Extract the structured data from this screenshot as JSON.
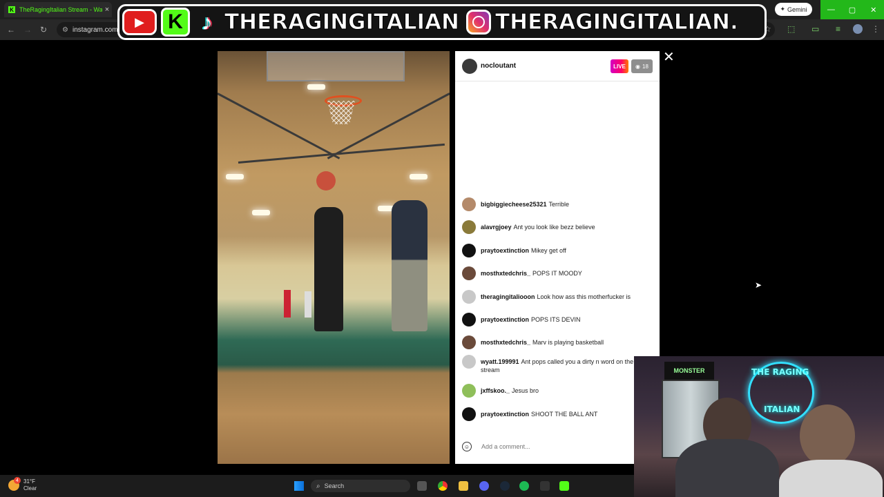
{
  "browser": {
    "tab_title": "TheRagingItalian Stream - Wat",
    "tab_close": "×",
    "url": "instagram.com/",
    "gemini_label": "Gemini",
    "window_controls": [
      "—",
      "▢",
      "✕"
    ]
  },
  "overlay": {
    "kick_letter": "K",
    "tiktok_glyph": "♪",
    "handle_1": "THERAGINGITALIAN",
    "handle_2": "THERAGINGITALIAN."
  },
  "live_panel": {
    "host": "nocloutant",
    "live_label": "LIVE",
    "viewer_count": "18",
    "comments": [
      {
        "user": "bigbiggiecheese25321",
        "text": "Terrible",
        "avatar_color": "#b48a6a"
      },
      {
        "user": "alavrgjoey",
        "text": "Ant you look like bezz believe",
        "avatar_color": "#8a7a3a"
      },
      {
        "user": "praytoextinction",
        "text": "Mikey get off",
        "avatar_color": "#111111"
      },
      {
        "user": "mosthxtedchris_",
        "text": "POPS IT MOODY",
        "avatar_color": "#6a4a3a"
      },
      {
        "user": "theragingitaliooon",
        "text": "Look how ass this motherfucker is",
        "avatar_color": "#c8c8c8"
      },
      {
        "user": "praytoextinction",
        "text": "POPS ITS DEVIN",
        "avatar_color": "#111111"
      },
      {
        "user": "mosthxtedchris_",
        "text": "Marv is playing basketball",
        "avatar_color": "#6a4a3a"
      },
      {
        "user": "wyatt.199991",
        "text": "Ant pops called you a dirty n word on the stream",
        "avatar_color": "#c8c8c8"
      },
      {
        "user": "jxffskoo._",
        "text": "Jesus bro",
        "avatar_color": "#8fbf5a"
      },
      {
        "user": "praytoextinction",
        "text": "SHOOT THE BALL ANT",
        "avatar_color": "#111111"
      }
    ],
    "comment_placeholder": "Add a comment..."
  },
  "taskbar": {
    "weather_temp": "31°F",
    "weather_desc": "Clear",
    "notification_count": "4",
    "search_label": "Search"
  },
  "webcam": {
    "neon_line1": "THE RAGING",
    "neon_line2": "ITALIAN",
    "fridge_brand": "MONSTER"
  },
  "colors": {
    "kick_green": "#53fc18",
    "instagram_live_gradient": "#ff0069",
    "youtube_red": "#e01e1e"
  }
}
